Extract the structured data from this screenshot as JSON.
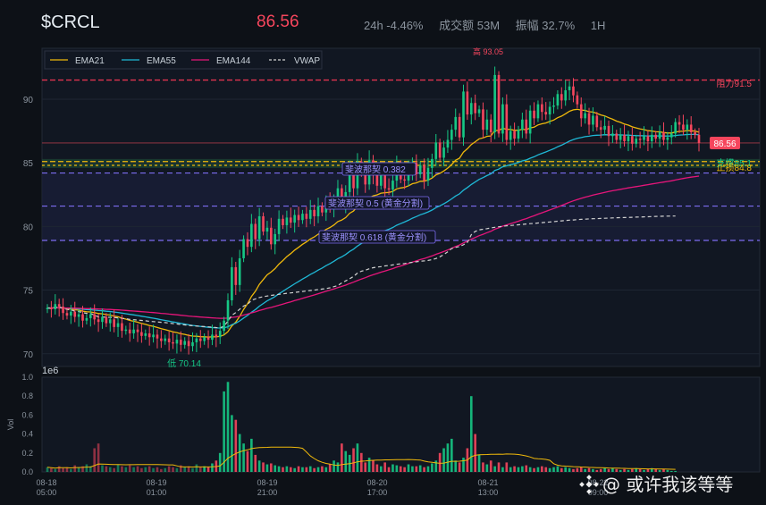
{
  "header": {
    "ticker": "$CRCL",
    "price": "86.56",
    "change": "24h -4.46%",
    "volume": "成交额 53M",
    "amplitude": "振幅 32.7%",
    "interval": "1H"
  },
  "colors": {
    "up": "#16c784",
    "down": "#f6465d",
    "ema21": "#f0b90b",
    "ema55": "#1fb8d6",
    "ema144": "#e6157a",
    "wwap": "#d0d0d0",
    "fib": "#7c6cf0",
    "resistance": "#e0334f",
    "support": "#f0b90b",
    "stop": "#f0b90b"
  },
  "legend": [
    "EMA21",
    "EMA55",
    "EMA144",
    "VWAP"
  ],
  "annotations": {
    "high": "高 93.05",
    "low": "低 70.14",
    "resistance": "阻力91.5",
    "support": "支撑85.1",
    "stop": "止损84.8",
    "last_price": "86.56",
    "fib382": "斐波那契 0.382",
    "fib500": "斐波那契 0.5 (黄金分割)",
    "fib618": "斐波那契 0.618 (黄金分割)",
    "offset_label": "1e6"
  },
  "watermark": "@ 或许我该等等",
  "chart_data": [
    {
      "type": "candlestick",
      "title": "",
      "ylim": [
        69,
        94
      ],
      "y_ticks": [
        "70",
        "75",
        "80",
        "85",
        "90"
      ],
      "levels": {
        "resistance": 91.5,
        "support": 85.1,
        "stop": 84.8,
        "fib382": 84.2,
        "fib500": 81.6,
        "fib618": 78.9,
        "last": 86.56,
        "high": 93.05,
        "low": 70.14
      },
      "close": [
        73.6,
        73.5,
        73.9,
        73.7,
        73.2,
        73.0,
        73.3,
        72.9,
        73.1,
        72.6,
        72.8,
        73.1,
        72.7,
        72.5,
        72.9,
        72.4,
        72.7,
        72.1,
        72.4,
        71.8,
        71.9,
        71.6,
        71.9,
        71.7,
        71.4,
        71.6,
        71.3,
        71.5,
        71.2,
        71.0,
        71.2,
        70.9,
        70.8,
        71.1,
        70.7,
        71.0,
        70.6,
        70.9,
        71.2,
        71.0,
        71.3,
        71.1,
        71.5,
        71.3,
        71.8,
        72.6,
        74.2,
        76.8,
        75.4,
        77.5,
        79.0,
        78.4,
        80.2,
        79.0,
        80.8,
        79.6,
        79.9,
        78.6,
        79.4,
        80.6,
        80.1,
        80.7,
        80.3,
        80.9,
        80.5,
        81.0,
        80.6,
        81.3,
        80.8,
        81.6,
        81.1,
        81.9,
        81.5,
        82.1,
        83.0,
        81.7,
        82.7,
        84.4,
        83.0,
        85.1,
        84.2,
        83.3,
        85.2,
        84.1,
        83.2,
        84.0,
        83.0,
        82.9,
        83.6,
        84.9,
        83.7,
        83.6,
        84.4,
        85.0,
        84.1,
        84.8,
        83.6,
        84.6,
        85.3,
        86.6,
        85.4,
        86.2,
        86.8,
        87.6,
        88.6,
        87.0,
        90.6,
        88.8,
        89.7,
        88.9,
        89.2,
        87.6,
        88.4,
        87.4,
        91.9,
        87.3,
        89.6,
        86.8,
        87.5,
        86.9,
        87.6,
        88.4,
        87.3,
        89.1,
        88.5,
        89.6,
        89.0,
        88.8,
        89.4,
        89.5,
        90.4,
        89.9,
        90.7,
        91.0,
        90.3,
        89.6,
        88.5,
        88.9,
        88.0,
        88.7,
        87.8,
        87.6,
        87.9,
        87.1,
        87.3,
        86.8,
        87.2,
        86.7,
        87.1,
        86.5,
        86.9,
        86.8,
        87.1,
        86.7,
        87.2,
        86.9,
        87.4,
        86.8,
        87.0,
        87.3,
        88.2,
        88.0,
        87.6,
        88.0,
        87.4,
        87.2,
        86.56
      ],
      "volume": [
        0.05,
        0.04,
        0.03,
        0.06,
        0.04,
        0.05,
        0.03,
        0.07,
        0.05,
        0.06,
        0.08,
        0.06,
        0.25,
        0.3,
        0.07,
        0.06,
        0.05,
        0.04,
        0.08,
        0.06,
        0.05,
        0.07,
        0.05,
        0.06,
        0.04,
        0.05,
        0.06,
        0.04,
        0.05,
        0.03,
        0.04,
        0.06,
        0.05,
        0.04,
        0.07,
        0.05,
        0.06,
        0.04,
        0.08,
        0.05,
        0.06,
        0.05,
        0.09,
        0.12,
        0.2,
        0.85,
        0.95,
        0.6,
        0.55,
        0.4,
        0.3,
        0.22,
        0.35,
        0.18,
        0.12,
        0.1,
        0.08,
        0.09,
        0.07,
        0.06,
        0.05,
        0.06,
        0.05,
        0.04,
        0.06,
        0.05,
        0.05,
        0.06,
        0.04,
        0.05,
        0.06,
        0.05,
        0.08,
        0.12,
        0.1,
        0.3,
        0.22,
        0.18,
        0.25,
        0.3,
        0.2,
        0.1,
        0.15,
        0.12,
        0.08,
        0.06,
        0.1,
        0.05,
        0.08,
        0.07,
        0.06,
        0.05,
        0.08,
        0.06,
        0.06,
        0.07,
        0.05,
        0.06,
        0.09,
        0.12,
        0.2,
        0.25,
        0.3,
        0.35,
        0.12,
        0.1,
        0.15,
        0.25,
        0.8,
        0.4,
        0.18,
        0.1,
        0.08,
        0.12,
        0.06,
        0.1,
        0.05,
        0.1,
        0.05,
        0.06,
        0.05,
        0.06,
        0.07,
        0.05,
        0.04,
        0.05,
        0.06,
        0.05,
        0.04,
        0.05,
        0.06,
        0.04,
        0.05,
        0.04,
        0.03,
        0.04,
        0.05,
        0.03,
        0.04,
        0.03,
        0.02,
        0.03,
        0.04,
        0.03,
        0.04,
        0.03,
        0.02,
        0.03,
        0.02,
        0.03,
        0.04,
        0.03,
        0.02,
        0.03,
        0.04,
        0.03,
        0.02,
        0.03,
        0.02,
        0.01,
        0.01
      ],
      "vol_ylabel": "Vol",
      "vol_ticks": [
        "0.0",
        "0.2",
        "0.4",
        "0.6",
        "0.8",
        "1.0"
      ],
      "x_ticks": [
        {
          "label": "08-18",
          "time": "05:00"
        },
        {
          "label": "08-19",
          "time": "01:00"
        },
        {
          "label": "08-19",
          "time": "21:00"
        },
        {
          "label": "08-20",
          "time": "17:00"
        },
        {
          "label": "08-21",
          "time": "13:00"
        },
        {
          "label": "08-22",
          "time": "09:00"
        }
      ]
    }
  ]
}
